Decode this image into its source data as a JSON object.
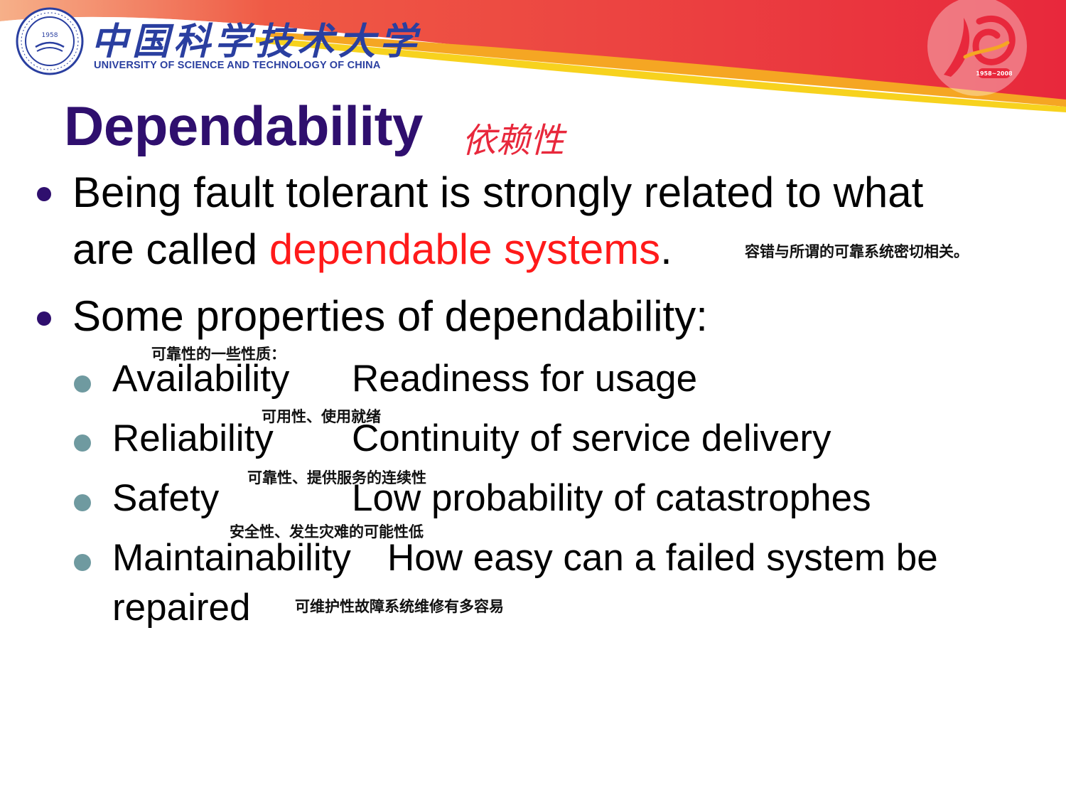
{
  "header": {
    "university_cn": "中国科学技术大学",
    "university_en": "UNIVERSITY OF SCIENCE AND TECHNOLOGY OF CHINA",
    "seal_year": "1958",
    "anniversary_years": "1958~2008",
    "colors": {
      "banner_red": "#e8283c",
      "banner_orange": "#f5a623",
      "banner_yellow": "#f7d21e",
      "logo_blue": "#2a3fa0"
    }
  },
  "slide": {
    "title": "Dependability",
    "title_note": "依赖性",
    "colors": {
      "title": "#2f0f6e",
      "highlight": "#ff1a1a",
      "sub_bullet": "#6f9aa0"
    },
    "bullets": [
      {
        "line1": "Being fault tolerant is strongly related to what",
        "line2_prefix": "are called ",
        "line2_highlight": "dependable systems",
        "line2_suffix": ".",
        "note": "容错与所谓的可靠系统密切相关。"
      },
      {
        "text": "Some properties of dependability:",
        "note": "可靠性的一些性质："
      }
    ],
    "properties": [
      {
        "term": "Availability",
        "desc": "Readiness for usage",
        "note": "可用性、使用就绪"
      },
      {
        "term": "Reliability",
        "desc": "Continuity of service delivery",
        "note": "可靠性、提供服务的连续性"
      },
      {
        "term": "Safety",
        "desc": "Low probability of catastrophes",
        "note": "安全性、发生灾难的可能性低"
      },
      {
        "term": "Maintainability",
        "desc": "How easy can a failed system be",
        "desc_cont": "repaired",
        "note": "可维护性故障系统维修有多容易"
      }
    ]
  }
}
